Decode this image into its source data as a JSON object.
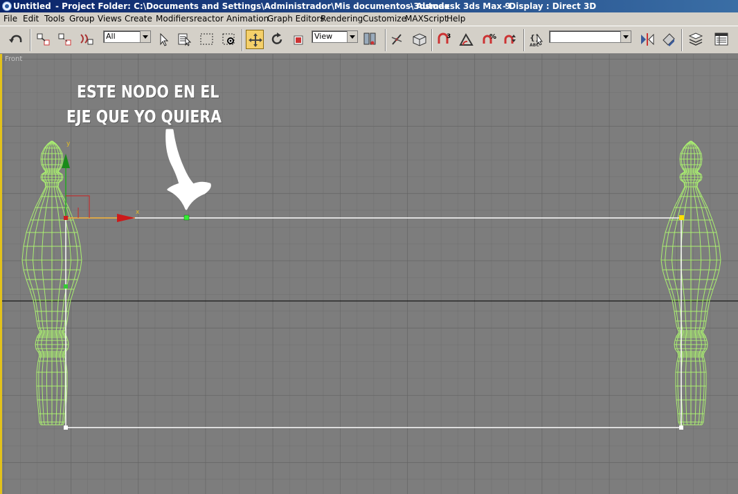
{
  "window": {
    "document": "Untitled",
    "project_folder": "- Project Folder: C:\\Documents and Settings\\Administrador\\Mis documentos\\3dsmax",
    "app": "- Autodesk 3ds Max 9",
    "display": "- Display : Direct 3D"
  },
  "menu": [
    "File",
    "Edit",
    "Tools",
    "Group",
    "Views",
    "Create",
    "Modifiers",
    "reactor",
    "Animation",
    "Graph Editors",
    "Rendering",
    "Customize",
    "MAXScript",
    "Help"
  ],
  "toolbar": {
    "selection_filter": "All",
    "reference_coord": "View",
    "named_selection": "",
    "icons": [
      "undo-icon",
      "select-link-icon",
      "unlink-icon",
      "bind-space-warp-icon",
      "select-object-icon",
      "select-by-name-icon",
      "rectangular-selection-icon",
      "window-crossing-icon",
      "select-and-move-icon",
      "select-and-rotate-icon",
      "select-and-scale-icon",
      "use-pivot-center-icon",
      "select-manipulate-icon",
      "keyboard-shortcut-icon",
      "snaps-toggle-icon",
      "angle-snap-icon",
      "percent-snap-icon",
      "spinner-snap-icon",
      "edit-named-selection-icon",
      "mirror-icon",
      "align-icon",
      "layer-manager-icon",
      "curve-editor-icon"
    ]
  },
  "viewport": {
    "label": "Front",
    "annotation_line1": "ESTE NODO EN EL",
    "annotation_line2": "EJE QUE YO QUIERA",
    "axis_x": "x",
    "axis_y": "y",
    "colors": {
      "background": "#7d7d7d",
      "wireframe": "#aaf070",
      "spline": "#ffffff",
      "grid": "#6e6e6e",
      "active_border": "#e3c21a"
    }
  }
}
